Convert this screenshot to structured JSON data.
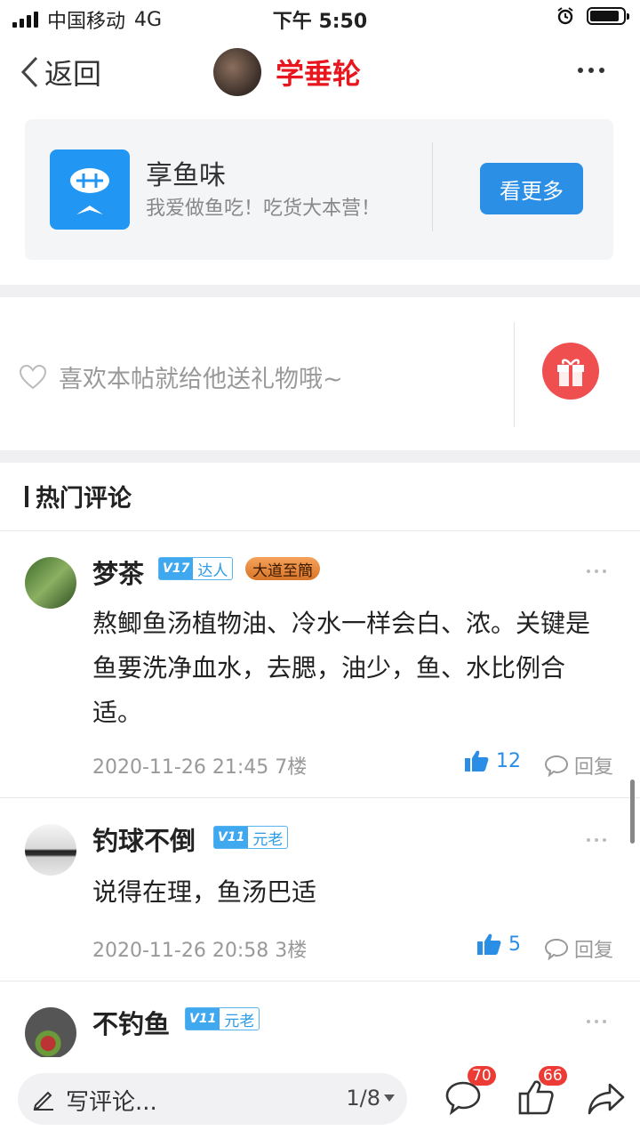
{
  "status_bar": {
    "carrier": "中国移动",
    "network": "4G",
    "time": "下午 5:50"
  },
  "nav": {
    "back_label": "返回",
    "title": "学垂轮"
  },
  "forum": {
    "name": "享鱼味",
    "desc": "我爱做鱼吃！吃货大本营！",
    "see_more": "看更多"
  },
  "gift": {
    "prompt": "喜欢本帖就给他送礼物哦~"
  },
  "hot_comments": {
    "title": "热门评论",
    "items": [
      {
        "name": "梦茶",
        "level": "V17",
        "role": "达人",
        "extra_badge": "大道至簡",
        "text": "熬鲫鱼汤植物油、冷水一样会白、浓。关键是鱼要洗净血水，去腮，油少，鱼、水比例合适。",
        "time": "2020-11-26 21:45",
        "floor": "7楼",
        "likes": "12",
        "reply": "回复"
      },
      {
        "name": "钓球不倒",
        "level": "V11",
        "role": "元老",
        "text": "说得在理，鱼汤巴适",
        "time": "2020-11-26 20:58",
        "floor": "3楼",
        "likes": "5",
        "reply": "回复"
      },
      {
        "name": "不钓鱼",
        "level": "V11",
        "role": "元老"
      }
    ]
  },
  "bottom_bar": {
    "write_label": "写评论...",
    "page": "1/8",
    "comment_count": "70",
    "like_count": "66"
  }
}
